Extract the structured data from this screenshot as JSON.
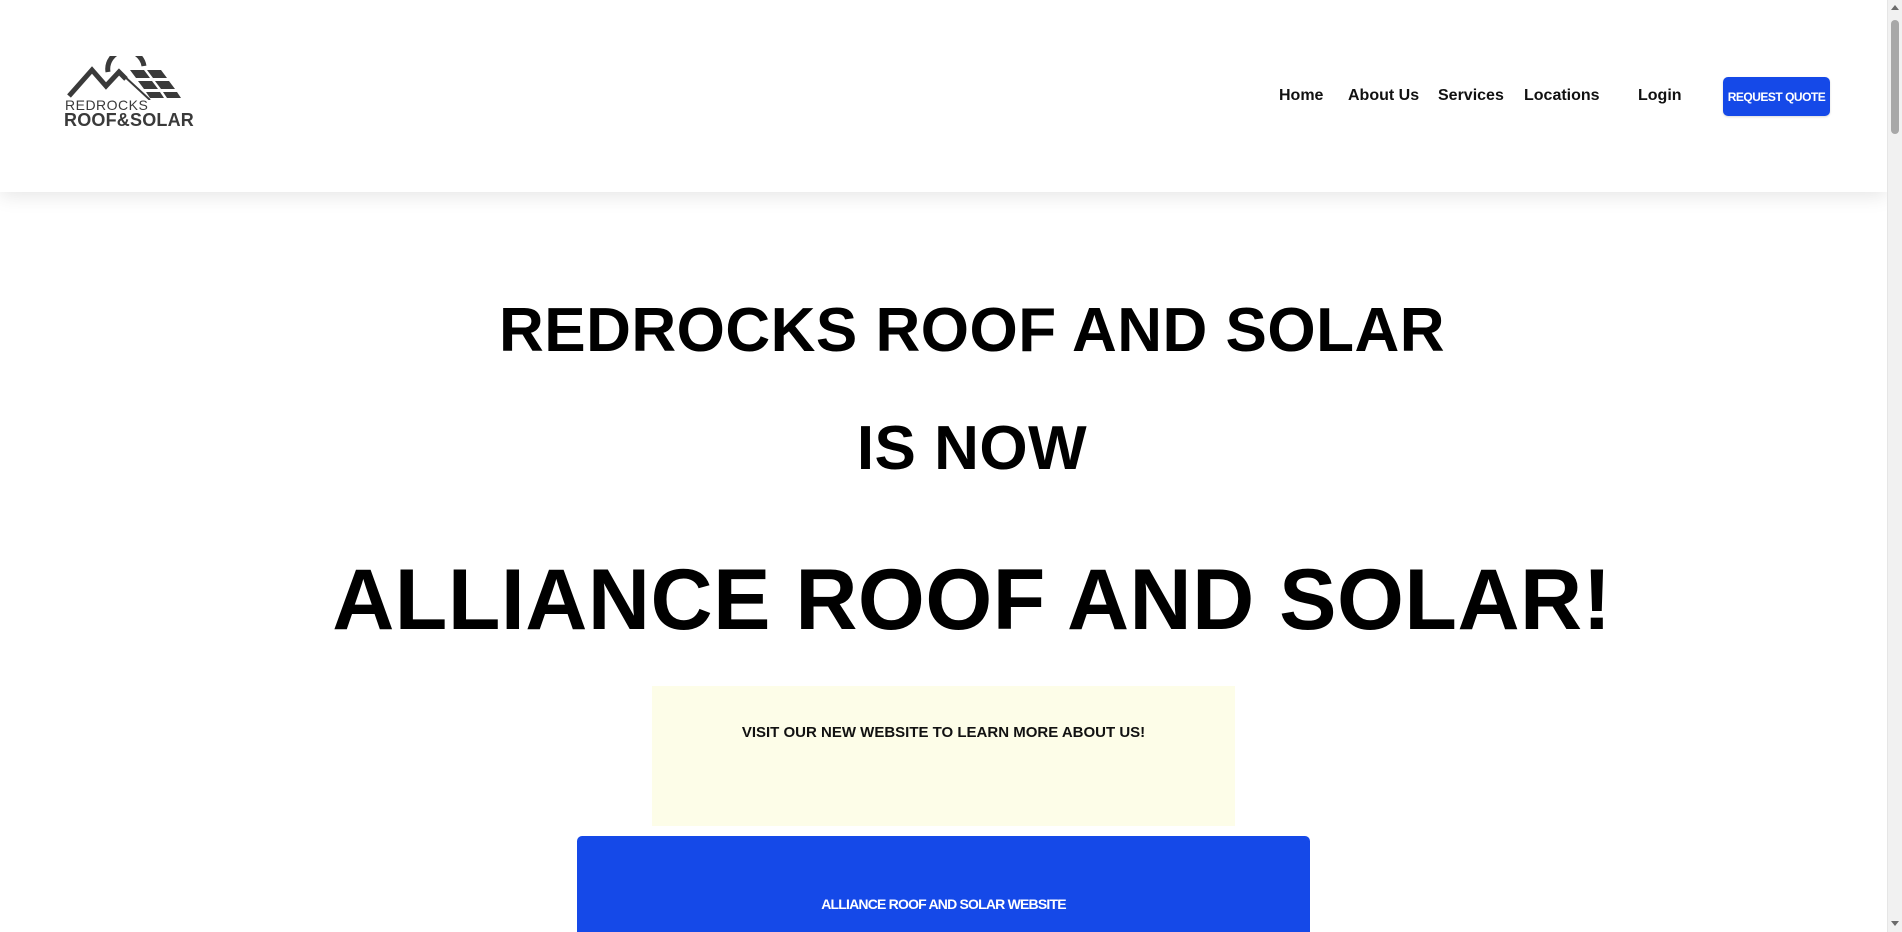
{
  "logo": {
    "line1": "REDROCKS",
    "line2": "ROOF&SOLAR",
    "icon": "roof-solar-logo-icon"
  },
  "nav": {
    "items": [
      {
        "label": "Home"
      },
      {
        "label": "About Us"
      },
      {
        "label": "Services"
      },
      {
        "label": "Locations"
      }
    ],
    "login_label": "Login",
    "quote_label": "REQUEST QUOTE"
  },
  "hero": {
    "line1": "REDROCKS ROOF AND SOLAR",
    "line2": "IS NOW",
    "line3": "ALLIANCE ROOF AND SOLAR!"
  },
  "notice": {
    "text": "VISIT OUR NEW WEBSITE TO LEARN MORE ABOUT US!"
  },
  "cta": {
    "label": "ALLIANCE ROOF AND SOLAR WEBSITE"
  },
  "colors": {
    "accent": "#1549e8",
    "notice_bg": "#fdfde8",
    "text": "#000000"
  }
}
